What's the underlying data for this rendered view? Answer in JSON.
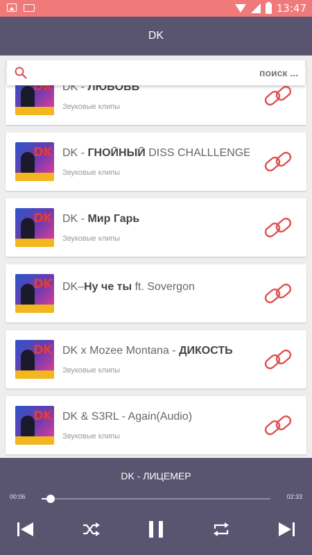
{
  "status_bar": {
    "time": "13:47"
  },
  "app_bar": {
    "title": "DK"
  },
  "search": {
    "placeholder": "поиск ..."
  },
  "list": {
    "items": [
      {
        "artist": "DK - ",
        "name": "ЛЮБОВЬ",
        "subtitle": "Звуковые клипы",
        "art_label": "DK"
      },
      {
        "artist": "DK - ",
        "name": "ГНОЙНЫЙ",
        "suffix": " DISS CHALLLENGE",
        "subtitle": "Звуковые клипы",
        "art_label": "DK"
      },
      {
        "artist": "DK - ",
        "name": "Мир Гарь",
        "subtitle": "Звуковые клипы",
        "art_label": "DK"
      },
      {
        "artist": "DK–",
        "name": "Ну че ты",
        "suffix": " ft. Sovergon",
        "subtitle": "",
        "art_label": "DK"
      },
      {
        "artist": "DK x Mozee Montana - ",
        "name": "ДИКОСТЬ",
        "subtitle": "Звуковые клипы",
        "art_label": "DK"
      },
      {
        "artist": "DK & S3RL - Again(Audio)",
        "name": "",
        "subtitle": "Звуковые клипы",
        "art_label": "DK"
      }
    ]
  },
  "player": {
    "track_title": "DK - ЛИЦЕМЕР",
    "current_time": "00:06",
    "total_time": "02:33",
    "progress": 0.04
  },
  "colors": {
    "status_bar": "#f07a7a",
    "app_bar": "#595470",
    "accent": "#e05050"
  }
}
